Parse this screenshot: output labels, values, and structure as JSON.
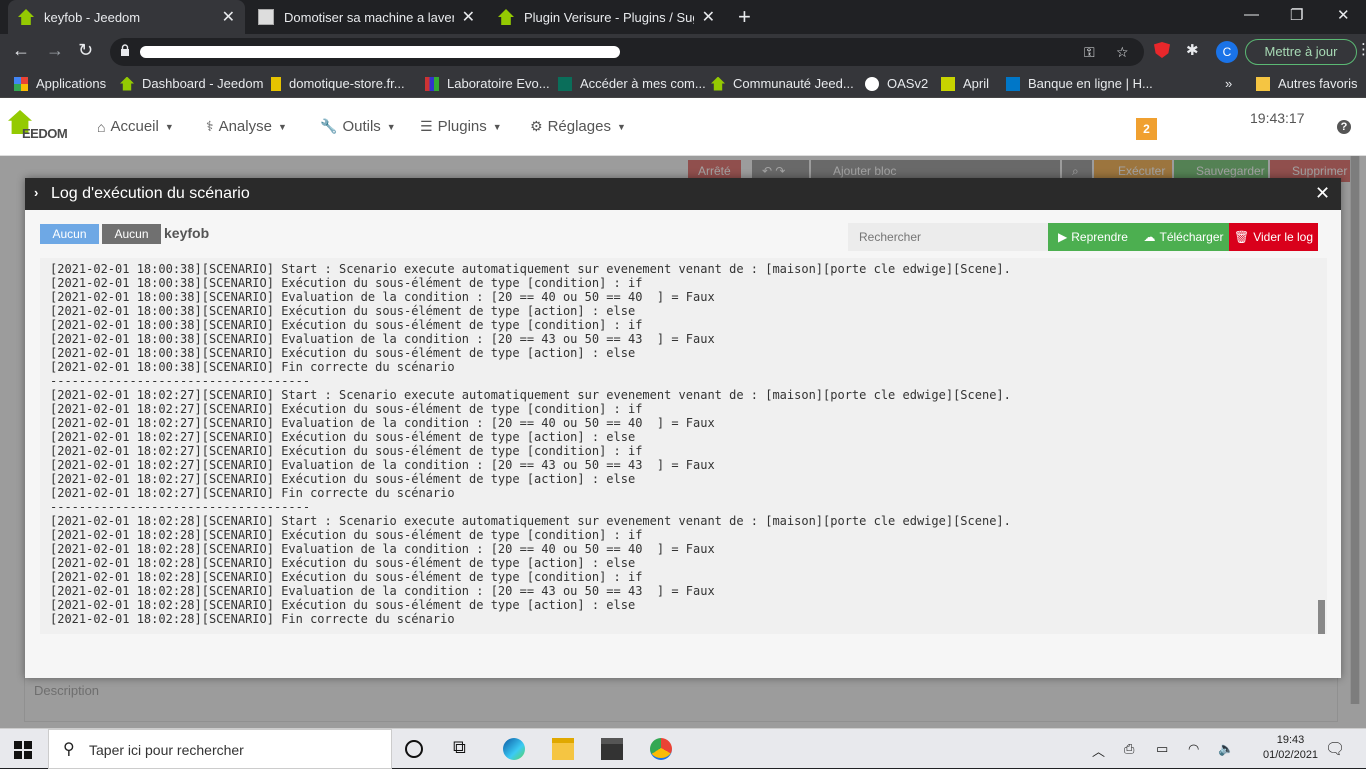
{
  "browser": {
    "tabs": [
      {
        "title": "keyfob - Jeedom",
        "active": true
      },
      {
        "title": "Domotiser sa machine a laver via",
        "active": false
      },
      {
        "title": "Plugin Verisure - Plugins / Sugge",
        "active": false
      }
    ],
    "new_tab": "+",
    "window_controls": [
      "—",
      "❐",
      "✕"
    ],
    "nav": {
      "back": "←",
      "forward": "→",
      "reload": "↻"
    },
    "update_button": "Mettre à jour",
    "avatar_letter": "C",
    "bookmarks": [
      {
        "label": "Applications"
      },
      {
        "label": "Dashboard - Jeedom"
      },
      {
        "label": "domotique-store.fr..."
      },
      {
        "label": "Laboratoire Evo..."
      },
      {
        "label": "Accéder à mes com..."
      },
      {
        "label": "Communauté Jeed..."
      },
      {
        "label": "OASv2"
      },
      {
        "label": "April"
      },
      {
        "label": "Banque en ligne | H..."
      }
    ],
    "bookmarks_overflow": "»",
    "other_bookmarks": "Autres favoris"
  },
  "app": {
    "logo_text": "EEDOM",
    "menu": [
      {
        "icon": "⌂",
        "label": "Accueil"
      },
      {
        "icon": "⚕",
        "label": "Analyse"
      },
      {
        "icon": "🔧",
        "label": "Outils"
      },
      {
        "icon": "☰",
        "label": "Plugins"
      },
      {
        "icon": "⚙",
        "label": "Réglages"
      }
    ],
    "caret": "▼",
    "notif_count": "2",
    "clock": "19:43:17",
    "help": "?",
    "background_buttons": {
      "stop": "Arrêté",
      "add_block": "Ajouter bloc",
      "execute": "Exécuter",
      "save": "Sauvegarder",
      "delete": "Supprimer"
    },
    "description_placeholder": "Description"
  },
  "modal": {
    "title": "Log d'exécution du scénario",
    "chevron": "›",
    "close": "✕",
    "tag_one": "Aucun",
    "tag_two": "Aucun",
    "scenario_name": "keyfob",
    "search_placeholder": "Rechercher",
    "buttons": {
      "resume": "Reprendre",
      "download": "Télécharger",
      "clear": "Vider le log"
    },
    "log_lines": [
      "[2021-02-01 18:00:38][SCENARIO] Start : Scenario execute automatiquement sur evenement venant de : [maison][porte cle edwige][Scene].",
      "[2021-02-01 18:00:38][SCENARIO] Exécution du sous-élément de type [condition] : if",
      "[2021-02-01 18:00:38][SCENARIO] Evaluation de la condition : [20 == 40 ou 50 == 40  ] = Faux",
      "[2021-02-01 18:00:38][SCENARIO] Exécution du sous-élément de type [action] : else",
      "[2021-02-01 18:00:38][SCENARIO] Exécution du sous-élément de type [condition] : if",
      "[2021-02-01 18:00:38][SCENARIO] Evaluation de la condition : [20 == 43 ou 50 == 43  ] = Faux",
      "[2021-02-01 18:00:38][SCENARIO] Exécution du sous-élément de type [action] : else",
      "[2021-02-01 18:00:38][SCENARIO] Fin correcte du scénario",
      "------------------------------------",
      "[2021-02-01 18:02:27][SCENARIO] Start : Scenario execute automatiquement sur evenement venant de : [maison][porte cle edwige][Scene].",
      "[2021-02-01 18:02:27][SCENARIO] Exécution du sous-élément de type [condition] : if",
      "[2021-02-01 18:02:27][SCENARIO] Evaluation de la condition : [20 == 40 ou 50 == 40  ] = Faux",
      "[2021-02-01 18:02:27][SCENARIO] Exécution du sous-élément de type [action] : else",
      "[2021-02-01 18:02:27][SCENARIO] Exécution du sous-élément de type [condition] : if",
      "[2021-02-01 18:02:27][SCENARIO] Evaluation de la condition : [20 == 43 ou 50 == 43  ] = Faux",
      "[2021-02-01 18:02:27][SCENARIO] Exécution du sous-élément de type [action] : else",
      "[2021-02-01 18:02:27][SCENARIO] Fin correcte du scénario",
      "------------------------------------",
      "[2021-02-01 18:02:28][SCENARIO] Start : Scenario execute automatiquement sur evenement venant de : [maison][porte cle edwige][Scene].",
      "[2021-02-01 18:02:28][SCENARIO] Exécution du sous-élément de type [condition] : if",
      "[2021-02-01 18:02:28][SCENARIO] Evaluation de la condition : [20 == 40 ou 50 == 40  ] = Faux",
      "[2021-02-01 18:02:28][SCENARIO] Exécution du sous-élément de type [action] : else",
      "[2021-02-01 18:02:28][SCENARIO] Exécution du sous-élément de type [condition] : if",
      "[2021-02-01 18:02:28][SCENARIO] Evaluation de la condition : [20 == 43 ou 50 == 43  ] = Faux",
      "[2021-02-01 18:02:28][SCENARIO] Exécution du sous-élément de type [action] : else",
      "[2021-02-01 18:02:28][SCENARIO] Fin correcte du scénario"
    ]
  },
  "taskbar": {
    "search_placeholder": "Taper ici pour rechercher",
    "time": "19:43",
    "date": "01/02/2021"
  },
  "colors": {
    "jeedom_green": "#94ca02",
    "resume_green": "#4caf50",
    "download_green": "#4caf50",
    "clear_red": "#d9001b",
    "tag_blue": "#6ea8e5"
  }
}
